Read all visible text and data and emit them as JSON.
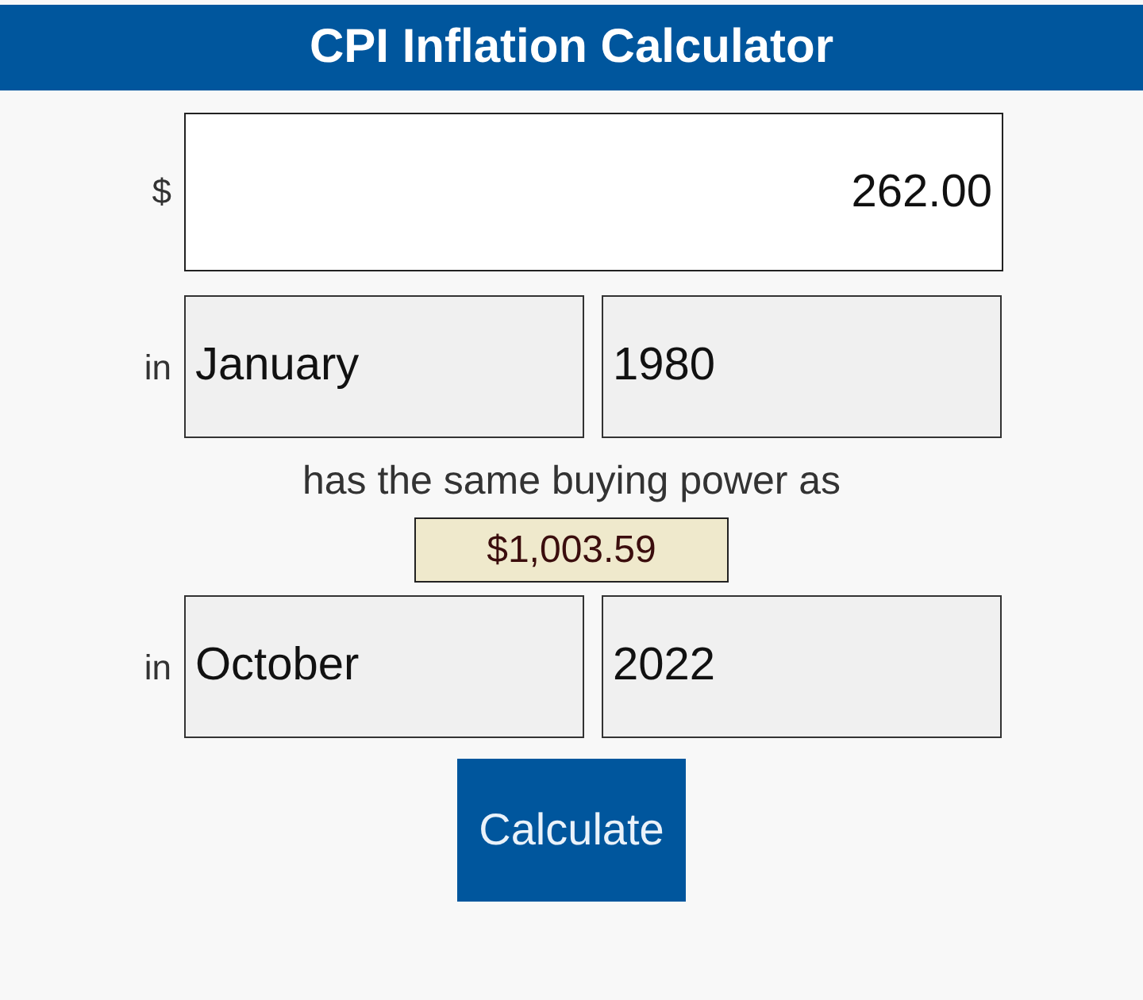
{
  "header": {
    "title": "CPI Inflation Calculator"
  },
  "amount": {
    "prefix": "$",
    "value": "262.00"
  },
  "from": {
    "prefix": "in",
    "month": "January",
    "year": "1980"
  },
  "result": {
    "text": "has the same buying power as",
    "value": "$1,003.59"
  },
  "to": {
    "prefix": "in",
    "month": "October",
    "year": "2022"
  },
  "button": {
    "label": "Calculate"
  }
}
